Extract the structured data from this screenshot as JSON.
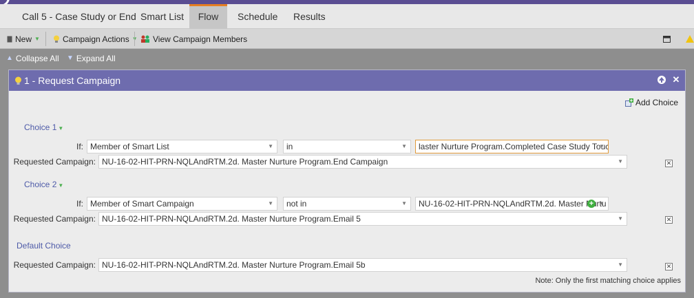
{
  "tabs": [
    {
      "label": "Call 5 - Case Study or End"
    },
    {
      "label": "Smart List"
    },
    {
      "label": "Flow"
    },
    {
      "label": "Schedule"
    },
    {
      "label": "Results"
    }
  ],
  "active_tab": "Flow",
  "toolbar": {
    "new_label": "New",
    "campaign_actions_label": "Campaign Actions",
    "view_members_label": "View Campaign Members"
  },
  "subtoolbar": {
    "collapse_all": "Collapse All",
    "expand_all": "Expand All"
  },
  "step": {
    "title": "1 - Request Campaign",
    "add_choice_label": "Add Choice",
    "choices": [
      {
        "label": "Choice 1",
        "if_label": "If:",
        "condition": "Member of Smart List",
        "operator": "in",
        "value": "laster Nurture Program.Completed Case Study Touch",
        "requested_label": "Requested Campaign:",
        "requested_campaign": "NU-16-02-HIT-PRN-NQLAndRTM.2d. Master Nurture Program.End Campaign"
      },
      {
        "label": "Choice 2",
        "if_label": "If:",
        "condition": "Member of Smart Campaign",
        "operator": "not in",
        "value": "NU-16-02-HIT-PRN-NQLAndRTM.2d. Master Nurtu",
        "requested_label": "Requested Campaign:",
        "requested_campaign": "NU-16-02-HIT-PRN-NQLAndRTM.2d. Master Nurture Program.Email 5"
      }
    ],
    "default_choice": {
      "label": "Default Choice",
      "requested_label": "Requested Campaign:",
      "requested_campaign": "NU-16-02-HIT-PRN-NQLAndRTM.2d. Master Nurture Program.Email 5b"
    },
    "note": "Note: Only the first matching choice applies"
  },
  "colors": {
    "header_purple": "#6e6cae",
    "link_blue": "#4d5aa8",
    "tab_accent": "#e67e22",
    "focus_orange": "#e09a3a"
  }
}
